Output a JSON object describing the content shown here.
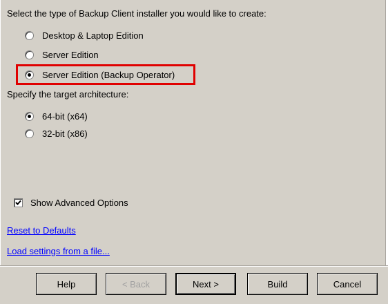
{
  "installer_type": {
    "prompt": "Select the type of Backup Client installer you would like to create:",
    "options": [
      {
        "label": "Desktop & Laptop Edition",
        "selected": false
      },
      {
        "label": "Server Edition",
        "selected": false
      },
      {
        "label": "Server Edition (Backup Operator)",
        "selected": true
      }
    ],
    "highlight_color": "#e00000"
  },
  "architecture": {
    "prompt": "Specify the target architecture:",
    "options": [
      {
        "label": "64-bit (x64)",
        "selected": true
      },
      {
        "label": "32-bit (x86)",
        "selected": false
      }
    ]
  },
  "advanced": {
    "label": "Show Advanced Options",
    "checked": true
  },
  "links": {
    "reset": "Reset to Defaults",
    "load": "Load settings from a file..."
  },
  "buttons": {
    "help": "Help",
    "back": "< Back",
    "next": "Next >",
    "build": "Build",
    "cancel": "Cancel"
  },
  "colors": {
    "background": "#d4d0c8",
    "link": "#0000ff"
  }
}
